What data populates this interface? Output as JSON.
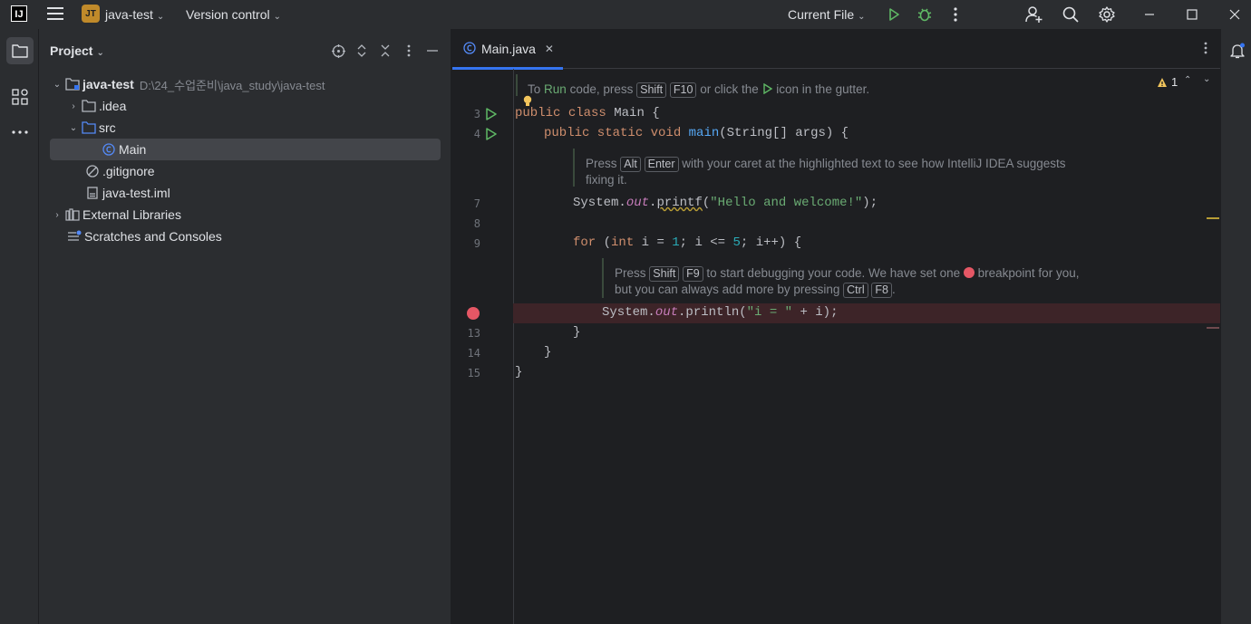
{
  "titlebar": {
    "logo_text": "IJ",
    "project_badge": "JT",
    "project_name": "java-test",
    "version_control": "Version control",
    "run_config": "Current File"
  },
  "project_panel": {
    "title": "Project",
    "tree": [
      {
        "label": "java-test",
        "path": "D:\\24_수업준비\\java_study\\java-test",
        "icon": "module-folder-icon"
      },
      {
        "label": ".idea",
        "icon": "folder-icon"
      },
      {
        "label": "src",
        "icon": "source-folder-icon"
      },
      {
        "label": "Main",
        "icon": "java-class-icon"
      },
      {
        "label": ".gitignore",
        "icon": "ignore-file-icon"
      },
      {
        "label": "java-test.iml",
        "icon": "iml-file-icon"
      },
      {
        "label": "External Libraries",
        "icon": "library-icon"
      },
      {
        "label": "Scratches and Consoles",
        "icon": "scratches-icon"
      }
    ]
  },
  "editor": {
    "tab_label": "Main.java",
    "warning_count": "1",
    "hint1": {
      "prefix": "To",
      "run": "Run",
      "mid": "code, press",
      "key1": "Shift",
      "key2": "F10",
      "after": "or click the",
      "end": "icon in the gutter."
    },
    "hint2": {
      "press": "Press",
      "key1": "Alt",
      "key2": "Enter",
      "text1": "with your caret at the highlighted text to see how IntelliJ IDEA suggests",
      "text2": "fixing it."
    },
    "hint3": {
      "press": "Press",
      "key1": "Shift",
      "key2": "F9",
      "text1": "to start debugging your code. We have set one",
      "text1b": "breakpoint for you,",
      "text2": "but you can always add more by pressing",
      "key3": "Ctrl",
      "key4": "F8",
      "end": "."
    },
    "line_numbers": [
      "3",
      "4",
      "7",
      "8",
      "9",
      "13",
      "14",
      "15"
    ],
    "code": {
      "l3_kw1": "public",
      "l3_kw2": "class",
      "l3_rest": "Main {",
      "l4_kw": "public static void",
      "l4_fn": "main",
      "l4_rest": "(String[] args) {",
      "l7_a": "System.",
      "l7_out": "out",
      "l7_b": ".",
      "l7_fn": "printf",
      "l7_c": "(",
      "l7_str": "\"Hello and welcome!\"",
      "l7_d": ");",
      "l9_kw": "for",
      "l9_a": " (",
      "l9_kw2": "int",
      "l9_b": " i = ",
      "l9_n1": "1",
      "l9_c": "; i <= ",
      "l9_n2": "5",
      "l9_d": "; i++) {",
      "l12_a": "System.",
      "l12_out": "out",
      "l12_b": ".println(",
      "l12_str": "\"i = \"",
      "l12_c": " + i);",
      "l13": "}",
      "l14": "}",
      "l15": "}"
    }
  },
  "colors": {
    "accent": "#3574f0",
    "run_green": "#5fb865",
    "breakpoint": "#e55765",
    "badge": "#c08a2a"
  }
}
